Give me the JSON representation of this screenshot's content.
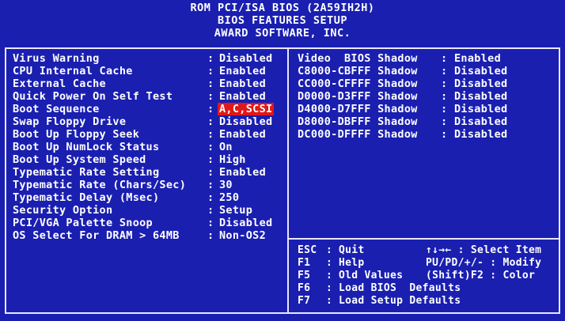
{
  "header": {
    "line1": "ROM PCI/ISA BIOS (2A59IH2H)",
    "line2": "BIOS FEATURES SETUP",
    "line3": "AWARD SOFTWARE, INC."
  },
  "colors": {
    "background": "#1a1fb0",
    "selected_value_bg": "#e01818",
    "text": "#ffffff"
  },
  "left_settings": [
    {
      "label": "Virus Warning",
      "value": "Disabled"
    },
    {
      "label": "CPU Internal Cache",
      "value": "Enabled"
    },
    {
      "label": "External Cache",
      "value": "Enabled"
    },
    {
      "label": "Quick Power On Self Test",
      "value": "Enabled"
    },
    {
      "label": "Boot Sequence",
      "value": "A,C,SCSI"
    },
    {
      "label": "Swap Floppy Drive",
      "value": "Disabled"
    },
    {
      "label": "Boot Up Floppy Seek",
      "value": "Enabled"
    },
    {
      "label": "Boot Up NumLock Status",
      "value": "On"
    },
    {
      "label": "Boot Up System Speed",
      "value": "High"
    },
    {
      "label": "Typematic Rate Setting",
      "value": "Enabled"
    },
    {
      "label": "Typematic Rate (Chars/Sec)",
      "value": "30"
    },
    {
      "label": "Typematic Delay (Msec)",
      "value": "250"
    },
    {
      "label": "Security Option",
      "value": "Setup"
    },
    {
      "label": "PCI/VGA Palette Snoop",
      "value": "Disabled"
    },
    {
      "label": "OS Select For DRAM > 64MB",
      "value": "Non-OS2"
    }
  ],
  "right_settings": [
    {
      "label": "Video  BIOS Shadow",
      "value": "Enabled"
    },
    {
      "label": "C8000-CBFFF Shadow",
      "value": "Disabled"
    },
    {
      "label": "CC000-CFFFF Shadow",
      "value": "Disabled"
    },
    {
      "label": "D0000-D3FFF Shadow",
      "value": "Disabled"
    },
    {
      "label": "D4000-D7FFF Shadow",
      "value": "Disabled"
    },
    {
      "label": "D8000-DBFFF Shadow",
      "value": "Disabled"
    },
    {
      "label": "DC000-DFFFF Shadow",
      "value": "Disabled"
    }
  ],
  "help": {
    "esc_key": "ESC",
    "esc_desc": "Quit",
    "f1_key": "F1",
    "f1_desc": "Help",
    "f5_key": "F5",
    "f5_desc": "Old Values",
    "f6_key": "F6",
    "f6_desc": "Load BIOS  Defaults",
    "f7_key": "F7",
    "f7_desc": "Load Setup Defaults",
    "arrows_key": "↑↓→← : Select Item",
    "pu_key": "PU/PD/+/- : Modify",
    "shift_key": "(Shift)F2 : Color"
  },
  "separator": ":"
}
